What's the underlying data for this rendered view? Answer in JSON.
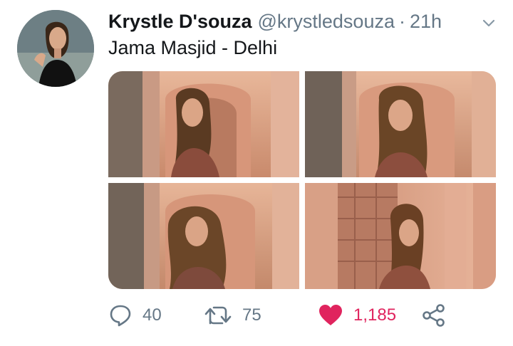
{
  "tweet": {
    "author_name": "Krystle D'souza",
    "author_handle": "@krystledsouza",
    "separator": "·",
    "time": "21h",
    "text": "Jama Masjid - Delhi",
    "photos": [
      {
        "label": "photo 1"
      },
      {
        "label": "photo 2"
      },
      {
        "label": "photo 3"
      },
      {
        "label": "photo 4"
      }
    ]
  },
  "actions": {
    "reply_count": "40",
    "retweet_count": "75",
    "like_count": "1,185"
  },
  "icons": {
    "caret": "chevron-down-icon",
    "reply": "reply-icon",
    "retweet": "retweet-icon",
    "like": "heart-icon",
    "share": "share-icon"
  },
  "colors": {
    "text": "#14171a",
    "secondary": "#657786",
    "like": "#e0245e"
  }
}
